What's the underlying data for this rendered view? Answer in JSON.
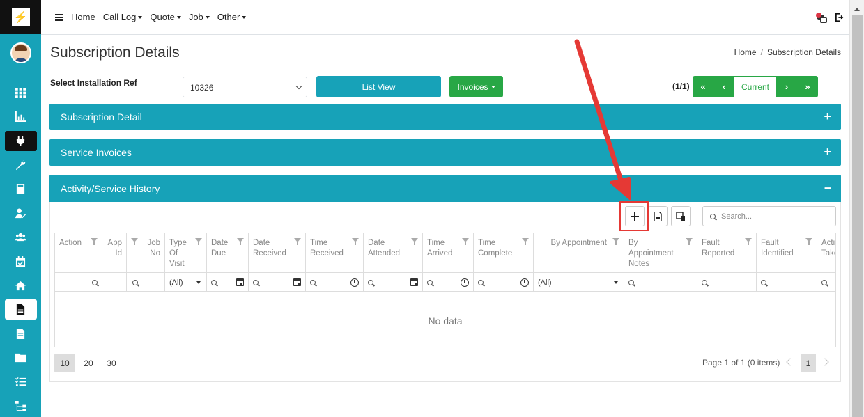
{
  "nav": {
    "items": [
      {
        "label": "Home",
        "has_caret": false
      },
      {
        "label": "Call Log",
        "has_caret": true
      },
      {
        "label": "Quote",
        "has_caret": true
      },
      {
        "label": "Job",
        "has_caret": true
      },
      {
        "label": "Other",
        "has_caret": true
      }
    ]
  },
  "sidebar": {
    "icons": [
      "grid-icon",
      "chart-icon",
      "plug-icon",
      "wrench-icon",
      "calculator-icon",
      "user-edit-icon",
      "users-icon",
      "calendar-check-icon",
      "home-icon",
      "file-invoice-icon",
      "file-icon",
      "folder-icon",
      "checklist-icon",
      "sitemap-icon"
    ]
  },
  "page": {
    "title": "Subscription Details",
    "breadcrumb": {
      "home": "Home",
      "sep": "/",
      "current": "Subscription Details"
    }
  },
  "form": {
    "select_label": "Select Installation Ref",
    "select_value": "10326",
    "list_view_label": "List View",
    "invoices_label": "Invoices"
  },
  "pager": {
    "count": "(1/1)",
    "first": "«",
    "prev": "‹",
    "current": "Current",
    "next": "›",
    "last": "»"
  },
  "panels": {
    "subscription_detail": {
      "title": "Subscription Detail",
      "toggle": "+"
    },
    "service_invoices": {
      "title": "Service Invoices",
      "toggle": "+"
    },
    "activity": {
      "title": "Activity/Service History",
      "toggle": "–"
    }
  },
  "grid": {
    "search_placeholder": "Search...",
    "headers": [
      "Action",
      "App Id",
      "Job No",
      "Type Of Visit",
      "Date Due",
      "Date Received",
      "Time Received",
      "Date Attended",
      "Time Arrived",
      "Time Complete",
      "By Appointment",
      "By Appointment Notes",
      "Fault Reported",
      "Fault Identified",
      "Action Taken"
    ],
    "filter_all_1": "(All)",
    "filter_all_2": "(All)",
    "no_data": "No data",
    "page_sizes": [
      "10",
      "20",
      "30"
    ],
    "page_info": "Page 1 of 1 (0 items)",
    "current_page": "1"
  },
  "colors": {
    "teal": "#17a2b8",
    "green": "#28a745",
    "red": "#e53935"
  }
}
